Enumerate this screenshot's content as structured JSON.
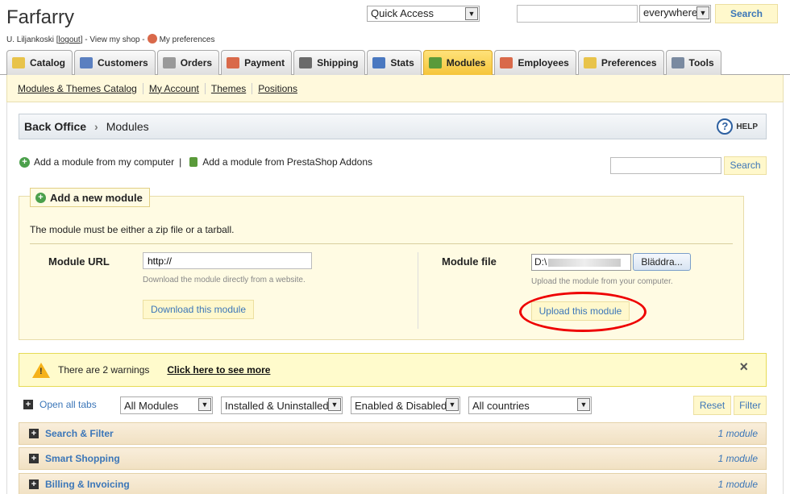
{
  "shop": {
    "name": "Farfarry"
  },
  "user_line": {
    "prefix": "U. Liljankoski [",
    "logout": "logout",
    "middle": "] - View my shop -",
    "preferences": "My preferences"
  },
  "quick_access": {
    "selected": "Quick Access"
  },
  "top_search": {
    "value": "",
    "scope": "everywhere",
    "button": "Search"
  },
  "tabs": [
    {
      "label": "Catalog",
      "icon": "folder-icon",
      "color": "#e8c34a"
    },
    {
      "label": "Customers",
      "icon": "customers-icon",
      "color": "#5a7fc0"
    },
    {
      "label": "Orders",
      "icon": "cart-icon",
      "color": "#999999"
    },
    {
      "label": "Payment",
      "icon": "payment-icon",
      "color": "#d9694a"
    },
    {
      "label": "Shipping",
      "icon": "truck-icon",
      "color": "#6a6a6a"
    },
    {
      "label": "Stats",
      "icon": "stats-icon",
      "color": "#4a78c0"
    },
    {
      "label": "Modules",
      "icon": "puzzle-icon",
      "color": "#5a9a3a",
      "active": true
    },
    {
      "label": "Employees",
      "icon": "employee-icon",
      "color": "#d9694a"
    },
    {
      "label": "Preferences",
      "icon": "preferences-icon",
      "color": "#e8c34a"
    },
    {
      "label": "Tools",
      "icon": "wrench-icon",
      "color": "#7a8aa0"
    }
  ],
  "subnav": [
    "Modules & Themes Catalog",
    "My Account",
    "Themes",
    "Positions"
  ],
  "breadcrumb": {
    "root": "Back Office",
    "current": "Modules",
    "help": "HELP"
  },
  "add_links": {
    "from_computer": "Add a module from my computer",
    "from_addons": "Add a module from PrestaShop Addons",
    "separator": "|"
  },
  "module_search": {
    "value": "",
    "button": "Search"
  },
  "add_module": {
    "title": "Add a new module",
    "description": "The module must be either a zip file or a tarball.",
    "url_label": "Module URL",
    "url_value": "http://",
    "url_hint": "Download the module directly from a website.",
    "download_button": "Download this module",
    "file_label": "Module file",
    "file_value": "D:\\",
    "browse_button": "Bläddra...",
    "file_hint": "Upload the module from your computer.",
    "upload_button": "Upload this module"
  },
  "warning": {
    "text": "There are 2 warnings",
    "link": "Click here to see more",
    "close": "×"
  },
  "filters": {
    "open_all": "Open all tabs",
    "modules": "All Modules",
    "install": "Installed & Uninstalled",
    "enabled": "Enabled & Disabled",
    "country": "All countries",
    "reset": "Reset",
    "filter": "Filter"
  },
  "categories": [
    {
      "name": "Search & Filter",
      "count": "1 module"
    },
    {
      "name": "Smart Shopping",
      "count": "1 module"
    },
    {
      "name": "Billing & Invoicing",
      "count": "1 module"
    }
  ]
}
